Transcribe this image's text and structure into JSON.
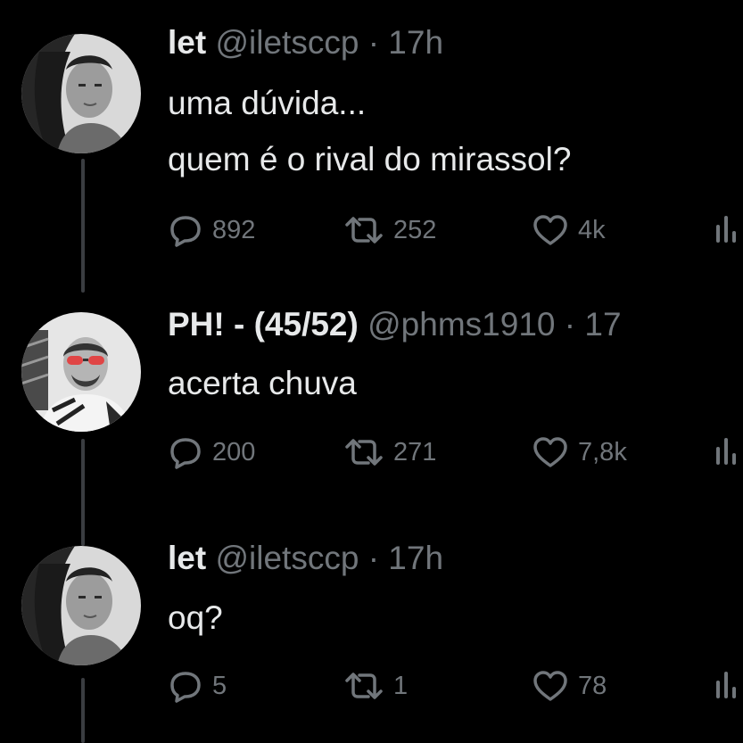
{
  "colors": {
    "background": "#000000",
    "text": "#e7e9ea",
    "muted": "#71767b",
    "thread_line": "#3a3d41"
  },
  "tweets": [
    {
      "name": "let",
      "handle": "@iletsccp",
      "separator": "·",
      "time": "17h",
      "lines": [
        "uma dúvida...",
        "quem é o rival do mirassol?"
      ],
      "replies": "892",
      "retweets": "252",
      "likes": "4k",
      "avatar": "woman-curly-hair-avatar"
    },
    {
      "name": "PH! - (45/52)",
      "handle": "@phms1910",
      "separator": "·",
      "time": "17",
      "lines": [
        "acerta chuva"
      ],
      "replies": "200",
      "retweets": "271",
      "likes": "7,8k",
      "avatar": "man-red-sunglasses-avatar"
    },
    {
      "name": "let",
      "handle": "@iletsccp",
      "separator": "·",
      "time": "17h",
      "lines": [
        "oq?"
      ],
      "replies": "5",
      "retweets": "1",
      "likes": "78",
      "avatar": "woman-curly-hair-avatar"
    }
  ],
  "icons": {
    "reply": "speech-bubble-icon",
    "retweet": "retweet-arrows-icon",
    "like": "heart-icon",
    "views": "bar-chart-icon"
  }
}
